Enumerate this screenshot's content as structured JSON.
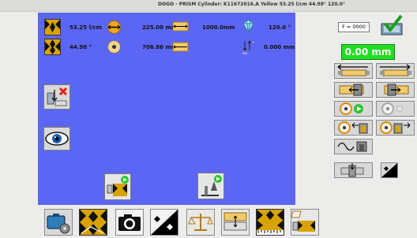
{
  "window": {
    "title": "DOGO - PRISM   Cylinder: K11672016.A   Yellow   53.25 l/cm 44.98° 120.0°"
  },
  "readouts": {
    "lpi": "53.25 l/cm",
    "angle": "44.98 °",
    "circumference": "225.00 mm",
    "diameter": "706.86 mm",
    "width": "1000.0mm",
    "stylus_angle": "120.0 °",
    "offset": "0.000 mm"
  },
  "side_panel": {
    "f_value": "F = 0000",
    "position": "0.00 mm"
  },
  "colors": {
    "main_bg": "#5c66f4",
    "green": "#22dd22"
  }
}
